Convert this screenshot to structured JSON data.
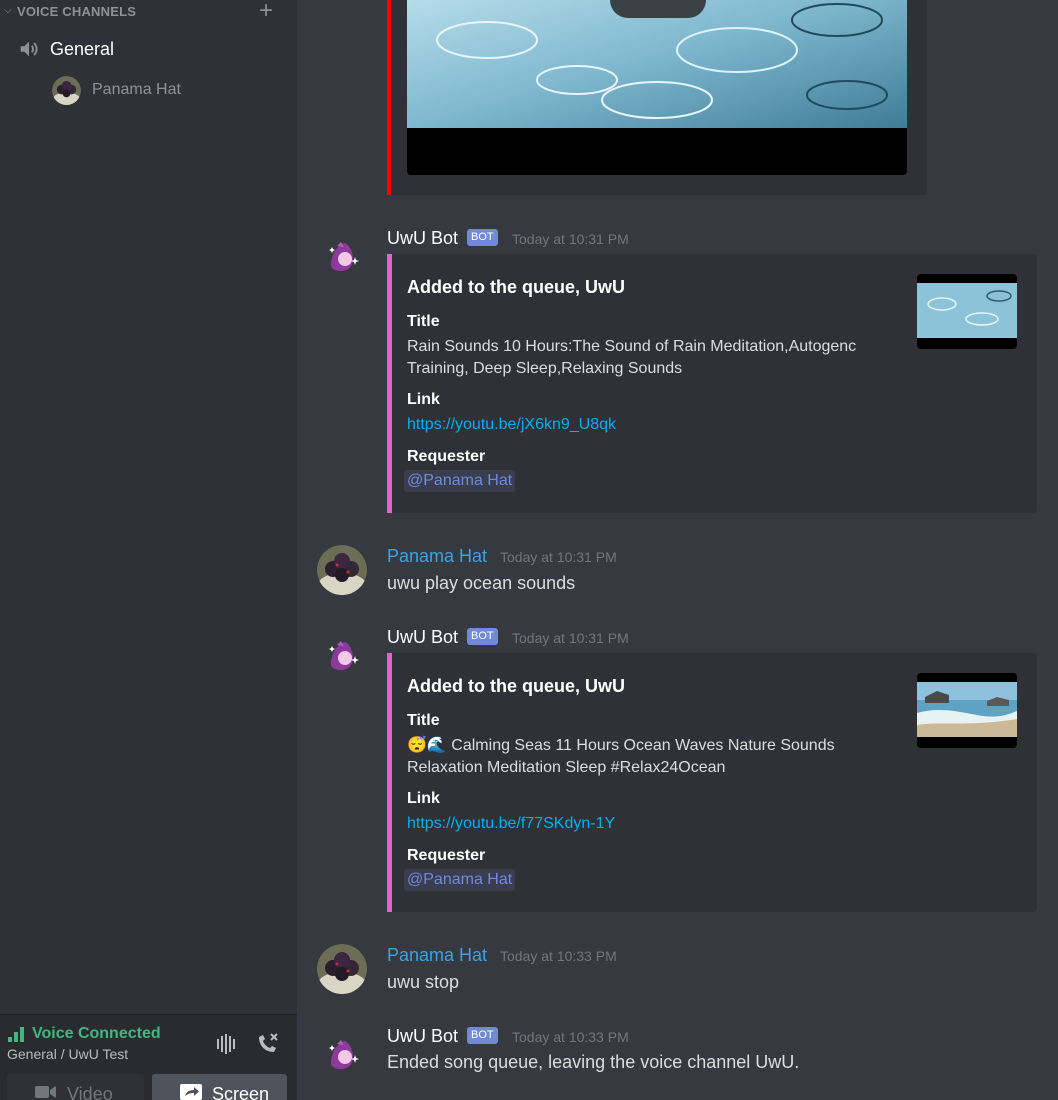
{
  "sidebar": {
    "category_label": "VOICE CHANNELS",
    "channel": {
      "name": "General"
    },
    "voice_user": {
      "name": "Panama Hat"
    }
  },
  "voice_panel": {
    "status": "Voice Connected",
    "location": "General / UwU Test",
    "video_label": "Video",
    "screen_label": "Screen",
    "status_color": "#43b581"
  },
  "messages": [
    {
      "author": "UwU Bot",
      "bot_tag": "BOT",
      "timestamp": "Today at 10:31 PM",
      "embed": {
        "title": "Added to the queue, UwU",
        "title_field": "Title",
        "title_value": "Rain Sounds 10 Hours:The Sound of Rain Meditation,Autogenc Training, Deep Sleep,Relaxing Sounds",
        "link_field": "Link",
        "link_value": "https://youtu.be/jX6kn9_U8qk",
        "requester_field": "Requester",
        "requester_value": "@Panama Hat"
      }
    },
    {
      "author": "Panama Hat",
      "timestamp": "Today at 10:31 PM",
      "text": "uwu play ocean sounds"
    },
    {
      "author": "UwU Bot",
      "bot_tag": "BOT",
      "timestamp": "Today at 10:31 PM",
      "embed": {
        "title": "Added to the queue, UwU",
        "title_field": "Title",
        "title_emoji": "😴🌊",
        "title_value": "Calming Seas 11 Hours Ocean Waves Nature Sounds Relaxation Meditation Sleep #Relax24Ocean",
        "link_field": "Link",
        "link_value": "https://youtu.be/f77SKdyn-1Y",
        "requester_field": "Requester",
        "requester_value": "@Panama Hat"
      }
    },
    {
      "author": "Panama Hat",
      "timestamp": "Today at 10:33 PM",
      "text": "uwu stop"
    },
    {
      "author": "UwU Bot",
      "bot_tag": "BOT",
      "timestamp": "Today at 10:33 PM",
      "text": "Ended song queue, leaving the voice channel UwU."
    }
  ],
  "colors": {
    "embed_accent": "#e066cf",
    "prev_embed_accent": "#ff0000",
    "user_name": "#3ca3e1",
    "link": "#00b0f4",
    "bot_tag": "#7289da"
  }
}
